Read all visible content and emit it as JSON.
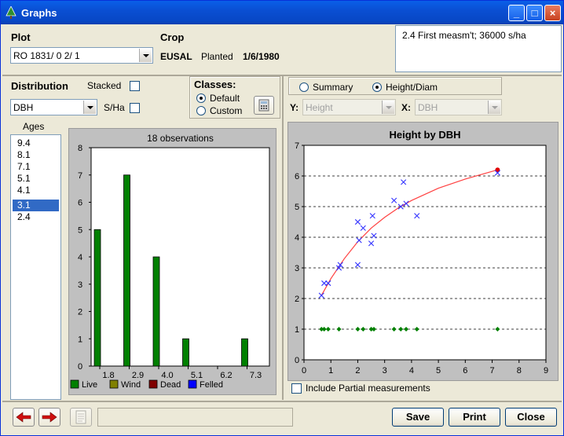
{
  "window": {
    "title": "Graphs",
    "minimize": "_",
    "maximize": "□",
    "close": "×"
  },
  "plot": {
    "label": "Plot",
    "value": "RO 1831/ 0   2/ 1"
  },
  "crop": {
    "label": "Crop",
    "species": "EUSAL",
    "planted_label": "Planted",
    "planted_date": "1/6/1980"
  },
  "info": {
    "text": "2.4  First measm't; 36000 s/ha"
  },
  "distribution": {
    "label": "Distribution",
    "value": "DBH",
    "stacked_label": "Stacked",
    "sha_label": "S/Ha"
  },
  "classes": {
    "label": "Classes:",
    "default_label": "Default",
    "custom_label": "Custom"
  },
  "ages": {
    "label": "Ages",
    "items": [
      "9.4",
      "8.1",
      "7.1",
      "5.1",
      "4.1",
      "3.1",
      "2.4"
    ],
    "selected": "3.1"
  },
  "view": {
    "summary_label": "Summary",
    "height_diam_label": "Height/Diam",
    "selected": "Height/Diam"
  },
  "axes_select": {
    "y_label": "Y:",
    "y_value": "Height",
    "x_label": "X:",
    "x_value": "DBH"
  },
  "include_partial_label": "Include Partial measurements",
  "legend": [
    {
      "name": "Live",
      "color": "#008000"
    },
    {
      "name": "Wind",
      "color": "#808000"
    },
    {
      "name": "Dead",
      "color": "#800000"
    },
    {
      "name": "Felled",
      "color": "#0000ff"
    }
  ],
  "buttons": {
    "save": "Save",
    "print": "Print",
    "close": "Close"
  },
  "chart_data": [
    {
      "type": "bar",
      "title": "18 observations",
      "categories": [
        "1.8",
        "2.9",
        "4.0",
        "5.1",
        "6.2",
        "7.3"
      ],
      "series": [
        {
          "name": "Live",
          "values": [
            5,
            7,
            4,
            1,
            0,
            1
          ]
        }
      ],
      "ylim": [
        0,
        8
      ],
      "yticks": [
        0,
        1,
        2,
        3,
        4,
        5,
        6,
        7,
        8
      ],
      "grid": false,
      "legend_position": "bottom"
    },
    {
      "type": "scatter",
      "title": "Height by DBH",
      "xlim": [
        0,
        9
      ],
      "ylim": [
        0,
        7
      ],
      "xticks": [
        0,
        1,
        2,
        3,
        4,
        5,
        6,
        7,
        8,
        9
      ],
      "yticks": [
        0,
        1,
        2,
        3,
        4,
        5,
        6,
        7
      ],
      "grid": "horizontal dashed",
      "points": [
        [
          0.65,
          2.1
        ],
        [
          0.75,
          2.5
        ],
        [
          0.9,
          2.5
        ],
        [
          1.3,
          3.0
        ],
        [
          1.35,
          3.1
        ],
        [
          2.0,
          3.1
        ],
        [
          2.0,
          4.5
        ],
        [
          2.05,
          3.9
        ],
        [
          2.2,
          4.3
        ],
        [
          2.5,
          3.8
        ],
        [
          2.55,
          4.7
        ],
        [
          2.6,
          4.05
        ],
        [
          3.35,
          5.2
        ],
        [
          3.6,
          5.0
        ],
        [
          3.7,
          5.8
        ],
        [
          3.8,
          5.1
        ],
        [
          4.2,
          4.7
        ],
        [
          7.2,
          6.1
        ]
      ],
      "baseline_x": [
        0.65,
        0.75,
        0.9,
        1.3,
        2.0,
        2.2,
        2.5,
        2.6,
        3.35,
        3.6,
        3.8,
        4.2,
        7.2
      ],
      "baseline_y": 1,
      "fit_curve": [
        [
          0.65,
          2.1
        ],
        [
          1.0,
          2.65
        ],
        [
          1.5,
          3.3
        ],
        [
          2.0,
          3.85
        ],
        [
          2.5,
          4.3
        ],
        [
          3.0,
          4.65
        ],
        [
          3.5,
          4.95
        ],
        [
          4.0,
          5.2
        ],
        [
          5.0,
          5.6
        ],
        [
          6.0,
          5.9
        ],
        [
          7.2,
          6.2
        ]
      ],
      "fit_end": [
        7.2,
        6.2
      ]
    }
  ]
}
